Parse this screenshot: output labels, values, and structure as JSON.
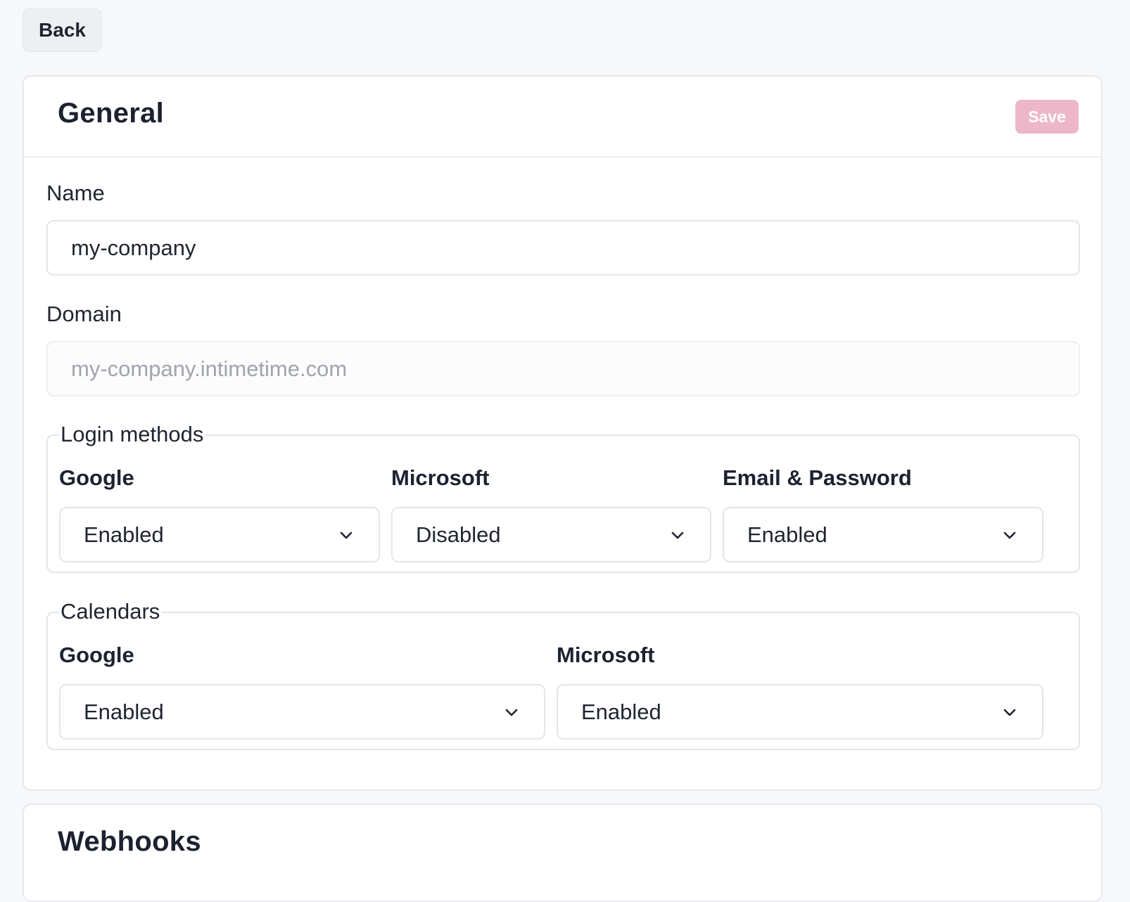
{
  "back_label": "Back",
  "general": {
    "title": "General",
    "save_label": "Save",
    "name": {
      "label": "Name",
      "value": "my-company"
    },
    "domain": {
      "label": "Domain",
      "value": "my-company.intimetime.com"
    },
    "login_methods": {
      "legend": "Login methods",
      "items": [
        {
          "label": "Google",
          "value": "Enabled"
        },
        {
          "label": "Microsoft",
          "value": "Disabled"
        },
        {
          "label": "Email & Password",
          "value": "Enabled"
        }
      ]
    },
    "calendars": {
      "legend": "Calendars",
      "items": [
        {
          "label": "Google",
          "value": "Enabled"
        },
        {
          "label": "Microsoft",
          "value": "Enabled"
        }
      ]
    }
  },
  "webhooks": {
    "title": "Webhooks"
  },
  "colors": {
    "save_accent": "#edb7c9",
    "background": "#f7f8f9",
    "border": "#e3e6eb"
  }
}
